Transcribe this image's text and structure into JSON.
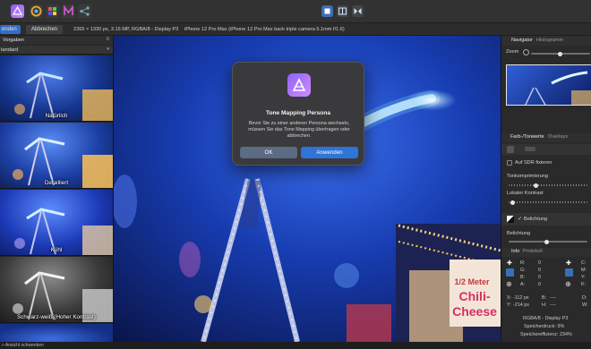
{
  "toolbar": {
    "icons": [
      "affinity-photo-persona-icon",
      "liquify-persona-icon",
      "develop-persona-icon",
      "tone-mapping-persona-icon",
      "export-persona-icon",
      "view-mode-icon",
      "split-view-icon",
      "mirror-view-icon"
    ]
  },
  "context_bar": {
    "apply_label": "enden",
    "cancel_label": "Abbrechen",
    "document_info": "2365 × 1330 px, 3.15 MP, RGBA/8 - Display P3",
    "camera_info": "iPhone 12 Pro Max (iPhone 12 Pro Max back triple camera 5.1mm f/1.6)"
  },
  "left_panel": {
    "tab_label": "Vorgaben",
    "preset_dropdown": "tandard",
    "presets": [
      {
        "label": "Natürlich"
      },
      {
        "label": "Detailliert"
      },
      {
        "label": "Kühl"
      },
      {
        "label": "Schwarz-weiß (Hoher Kontrast)"
      }
    ]
  },
  "dialog": {
    "title": "Tone Mapping Persona",
    "message": "Bevor Sie zu einer anderen Persona wechseln, müssen Sie das Tone Mapping übertragen oder abbrechen.",
    "ok_label": "OK",
    "apply_label": "Anwenden"
  },
  "right_panel": {
    "navigator_tab": "Navigator",
    "histogram_tab": "Histogramm",
    "zoom_label": "Zoom",
    "tonecurve_tab": "Farb-/Tonwerte",
    "overlays_tab": "Overlays",
    "sections": {
      "sdr_label": "Auf SDR fixieren",
      "tonemapping_label": "Tonkomprimierung",
      "local_contrast_label": "Lokaler Kontrast",
      "exposure_label": "Belichtung",
      "exposure_slider_label": "Belichtung"
    },
    "info_tab": "Info",
    "protocol_tab": "Protokoll",
    "readouts": {
      "r_label": "R:",
      "r_val": "0",
      "g_label": "G:",
      "g_val": "0",
      "b_label": "B:",
      "b_val": "0",
      "a_label": "A:",
      "a_val": "0",
      "c_label": "C:",
      "m_label": "M:",
      "y_label": "Y:",
      "k_label": "K:",
      "x_label": "X:",
      "x_val": "-112 px",
      "y_coord_label": "Y:",
      "y_val": "-214 px",
      "b2_label": "B:",
      "b2_val": "----",
      "h_label": "H:",
      "h_val": "----",
      "d_label": "D:",
      "w_label": "W:"
    },
    "summary": {
      "color_space": "RGBA/8 - Display P3",
      "memory_pressure": "Speicherdruck: 9%",
      "memory_efficiency": "Speichereffizienz: 234%"
    }
  },
  "status": {
    "hint": "» Ansicht schwenken"
  },
  "colors": {
    "accent": "#3a7fd6",
    "dialog_bg": "#3a3a3c",
    "panel_bg": "#2a2a2a"
  }
}
